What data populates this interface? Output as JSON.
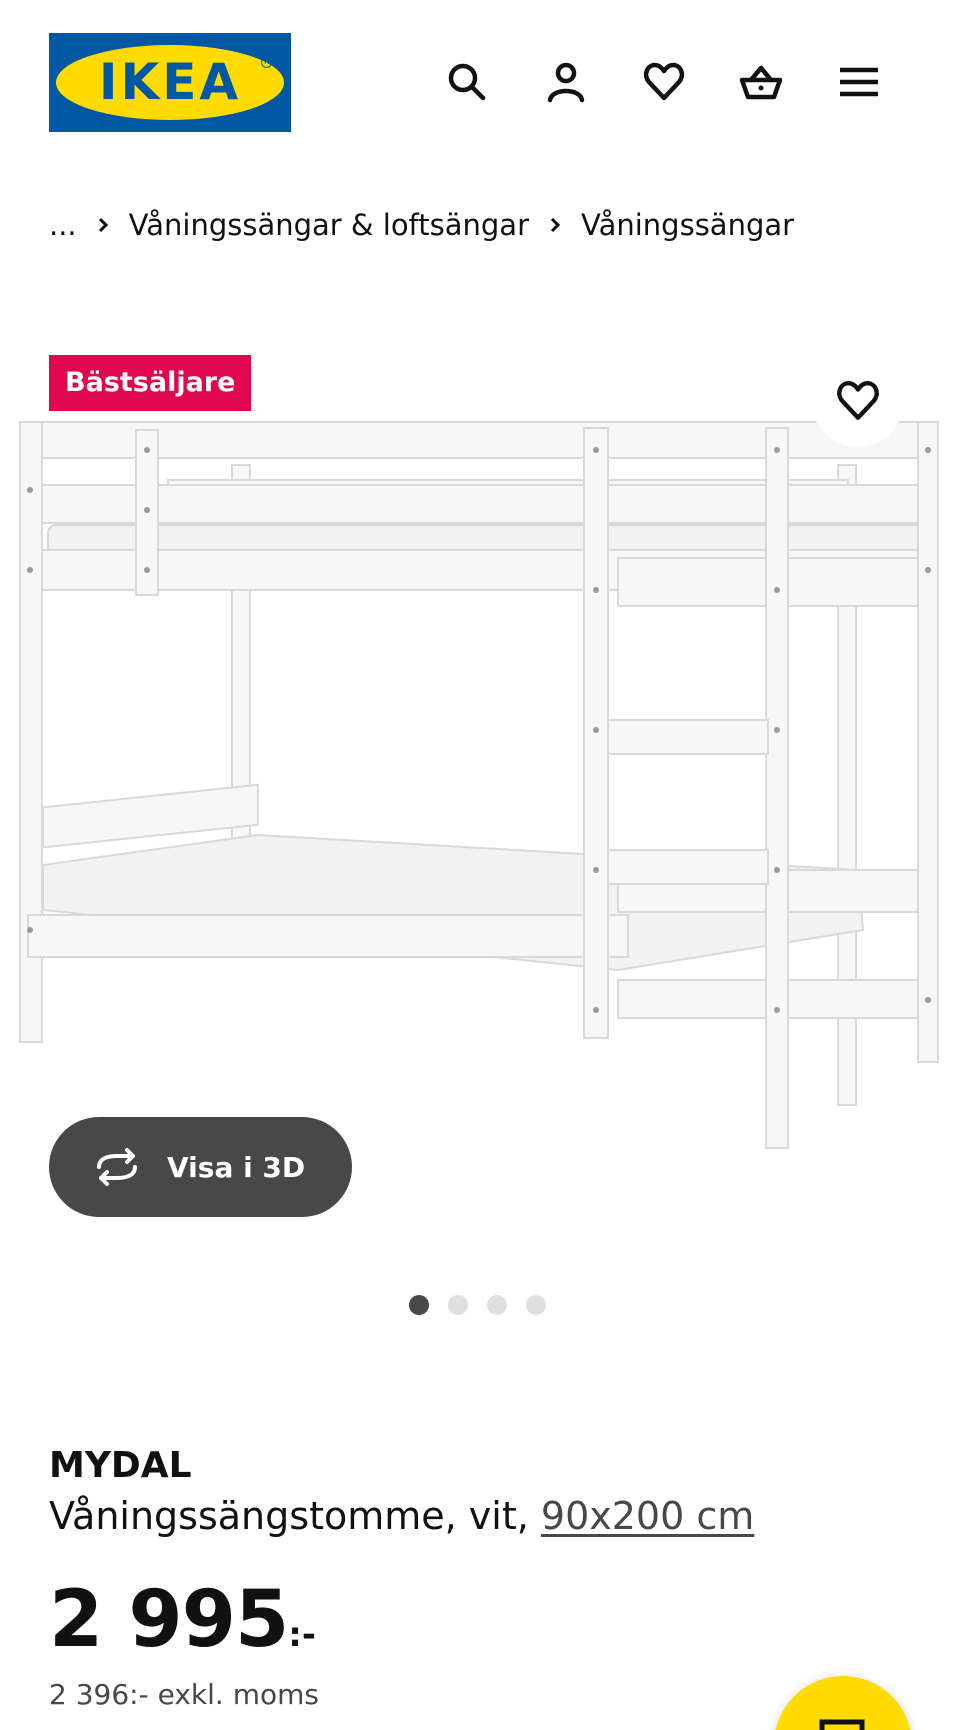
{
  "header": {
    "logo_text": "IKEA",
    "icons": [
      "search-icon",
      "account-icon",
      "heart-icon",
      "basket-icon",
      "menu-icon"
    ]
  },
  "breadcrumb": {
    "items": [
      "...",
      "Våningssängar & loftsängar",
      "Våningssängar"
    ]
  },
  "media": {
    "badge": "Bästsäljare",
    "view_3d_label": "Visa i 3D",
    "image_count": 4,
    "active_image": 1
  },
  "product": {
    "name": "MYDAL",
    "description": "Våningssängstomme, vit, ",
    "size_link": "90x200 cm",
    "price_amount": "2 995",
    "price_suffix": ":-",
    "price_excl_vat": "2 396:- exkl. moms"
  },
  "colors": {
    "ikea_blue": "#0058a3",
    "ikea_yellow": "#ffdb00",
    "badge_red": "#e00751",
    "dark_button": "#484848"
  }
}
